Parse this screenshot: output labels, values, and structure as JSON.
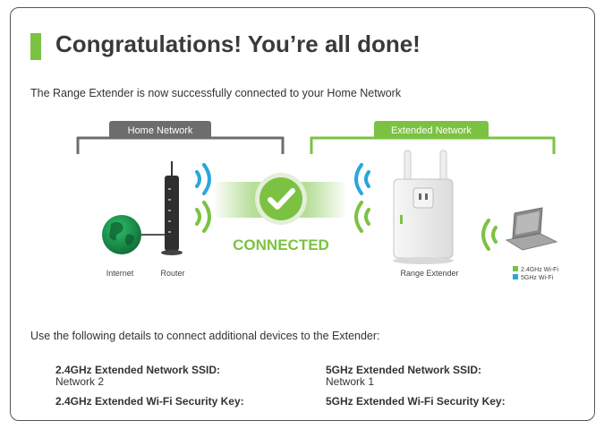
{
  "page": {
    "title": "Congratulations! You’re all done!",
    "subtitle": "The Range Extender is now successfully connected to your Home Network"
  },
  "diagram": {
    "home_network_label": "Home Network",
    "extended_network_label": "Extended Network",
    "connected_label": "CONNECTED",
    "internet_label": "Internet",
    "router_label": "Router",
    "range_extender_label": "Range Extender",
    "legend": [
      {
        "label": "2.4GHz Wi-Fi",
        "color": "#7cc242"
      },
      {
        "label": "5GHz Wi-Fi",
        "color": "#2aa6dc"
      }
    ],
    "colors": {
      "green": "#7cc242",
      "blue": "#2aa6dc",
      "gray": "#6d6d6d"
    }
  },
  "details": {
    "intro": "Use the following details to connect additional devices to the Extender:",
    "ssid_24_label": "2.4GHz Extended Network SSID:",
    "ssid_24_value": "Network 2",
    "ssid_5_label": "5GHz Extended Network SSID:",
    "ssid_5_value": "Network 1",
    "key_24_label": "2.4GHz Extended Wi-Fi Security Key:",
    "key_5_label": "5GHz Extended Wi-Fi Security Key:"
  }
}
